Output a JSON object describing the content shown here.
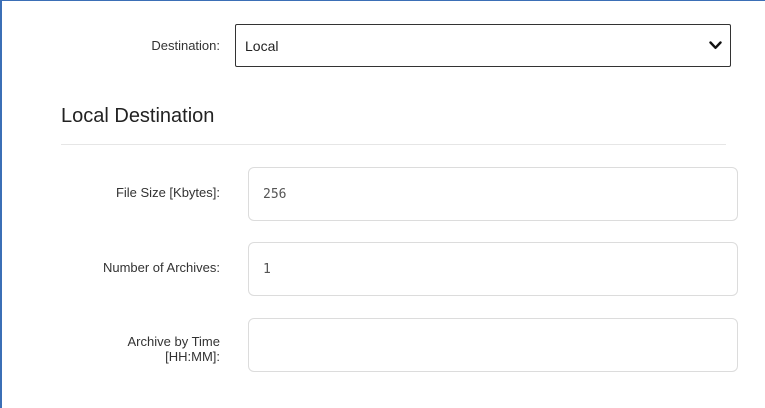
{
  "destination": {
    "label": "Destination:",
    "selected_value": "Local",
    "dropdown_icon": "chevron-down-icon"
  },
  "section": {
    "title": "Local Destination"
  },
  "fields": {
    "file_size": {
      "label": "File Size [Kbytes]:",
      "value": "256"
    },
    "number_of_archives": {
      "label": "Number of Archives:",
      "value": "1"
    },
    "archive_by_time": {
      "label_line1": "Archive by Time",
      "label_line2": "[HH:MM]:",
      "value": ""
    }
  },
  "colors": {
    "frame_border": "#3b6fb6",
    "divider": "#e6e6e6",
    "input_border": "#dcdcdc"
  }
}
